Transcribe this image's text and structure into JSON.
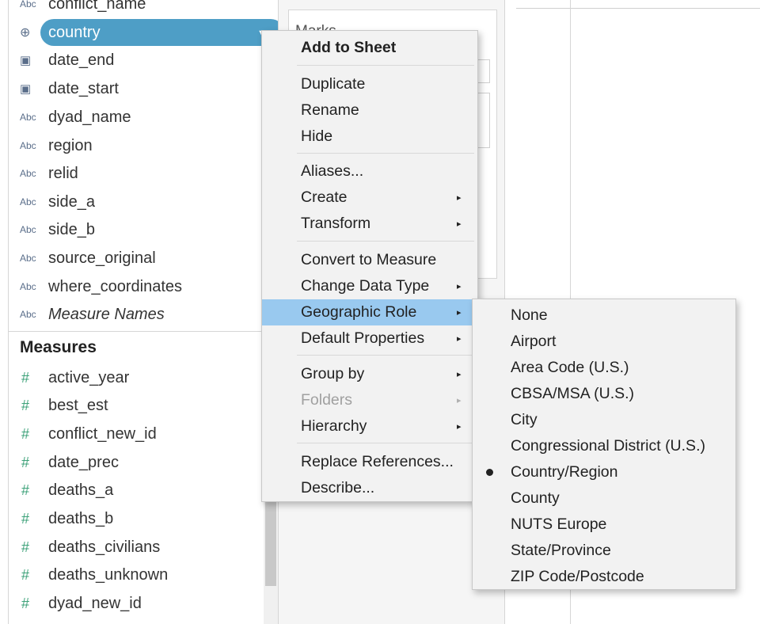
{
  "data_pane": {
    "dimensions": [
      {
        "label": "conflict_name",
        "icon": "Abc",
        "type": "string"
      },
      {
        "label": "country",
        "icon": "globe",
        "type": "geo",
        "selected": true
      },
      {
        "label": "date_end",
        "icon": "calendar",
        "type": "date"
      },
      {
        "label": "date_start",
        "icon": "calendar",
        "type": "date"
      },
      {
        "label": "dyad_name",
        "icon": "Abc",
        "type": "string"
      },
      {
        "label": "region",
        "icon": "Abc",
        "type": "string"
      },
      {
        "label": "relid",
        "icon": "Abc",
        "type": "string"
      },
      {
        "label": "side_a",
        "icon": "Abc",
        "type": "string"
      },
      {
        "label": "side_b",
        "icon": "Abc",
        "type": "string"
      },
      {
        "label": "source_original",
        "icon": "Abc",
        "type": "string"
      },
      {
        "label": "where_coordinates",
        "icon": "Abc",
        "type": "string"
      },
      {
        "label": "Measure Names",
        "icon": "Abc",
        "type": "string",
        "italic": true
      }
    ],
    "measures_header": "Measures",
    "measures": [
      {
        "label": "active_year",
        "icon": "#"
      },
      {
        "label": "best_est",
        "icon": "#"
      },
      {
        "label": "conflict_new_id",
        "icon": "#"
      },
      {
        "label": "date_prec",
        "icon": "#"
      },
      {
        "label": "deaths_a",
        "icon": "#"
      },
      {
        "label": "deaths_b",
        "icon": "#"
      },
      {
        "label": "deaths_civilians",
        "icon": "#"
      },
      {
        "label": "deaths_unknown",
        "icon": "#"
      },
      {
        "label": "dyad_new_id",
        "icon": "#"
      }
    ]
  },
  "marks_pane": {
    "title": "Marks"
  },
  "context_menu": {
    "items": [
      {
        "label": "Add to Sheet",
        "bold": true
      },
      {
        "label": "Duplicate"
      },
      {
        "label": "Rename"
      },
      {
        "label": "Hide"
      },
      {
        "label": "Aliases..."
      },
      {
        "label": "Create",
        "submenu": true
      },
      {
        "label": "Transform",
        "submenu": true
      },
      {
        "label": "Convert to Measure"
      },
      {
        "label": "Change Data Type",
        "submenu": true
      },
      {
        "label": "Geographic Role",
        "submenu": true,
        "active": true
      },
      {
        "label": "Default Properties",
        "submenu": true
      },
      {
        "label": "Group by",
        "submenu": true
      },
      {
        "label": "Folders",
        "submenu": true,
        "disabled": true
      },
      {
        "label": "Hierarchy",
        "submenu": true
      },
      {
        "label": "Replace References..."
      },
      {
        "label": "Describe..."
      }
    ],
    "arrow_glyph": "▸"
  },
  "geographic_role_submenu": {
    "items": [
      {
        "label": "None"
      },
      {
        "label": "Airport"
      },
      {
        "label": "Area Code (U.S.)"
      },
      {
        "label": "CBSA/MSA (U.S.)"
      },
      {
        "label": "City"
      },
      {
        "label": "Congressional District (U.S.)"
      },
      {
        "label": "Country/Region",
        "checked": true
      },
      {
        "label": "County"
      },
      {
        "label": "NUTS Europe"
      },
      {
        "label": "State/Province"
      },
      {
        "label": "ZIP Code/Postcode"
      }
    ]
  },
  "colors": {
    "selected_pill": "#4e9ec6",
    "menu_highlight": "#99c9ef",
    "measure_icon": "#3ea27a",
    "dimension_icon": "#5a6e8a"
  }
}
